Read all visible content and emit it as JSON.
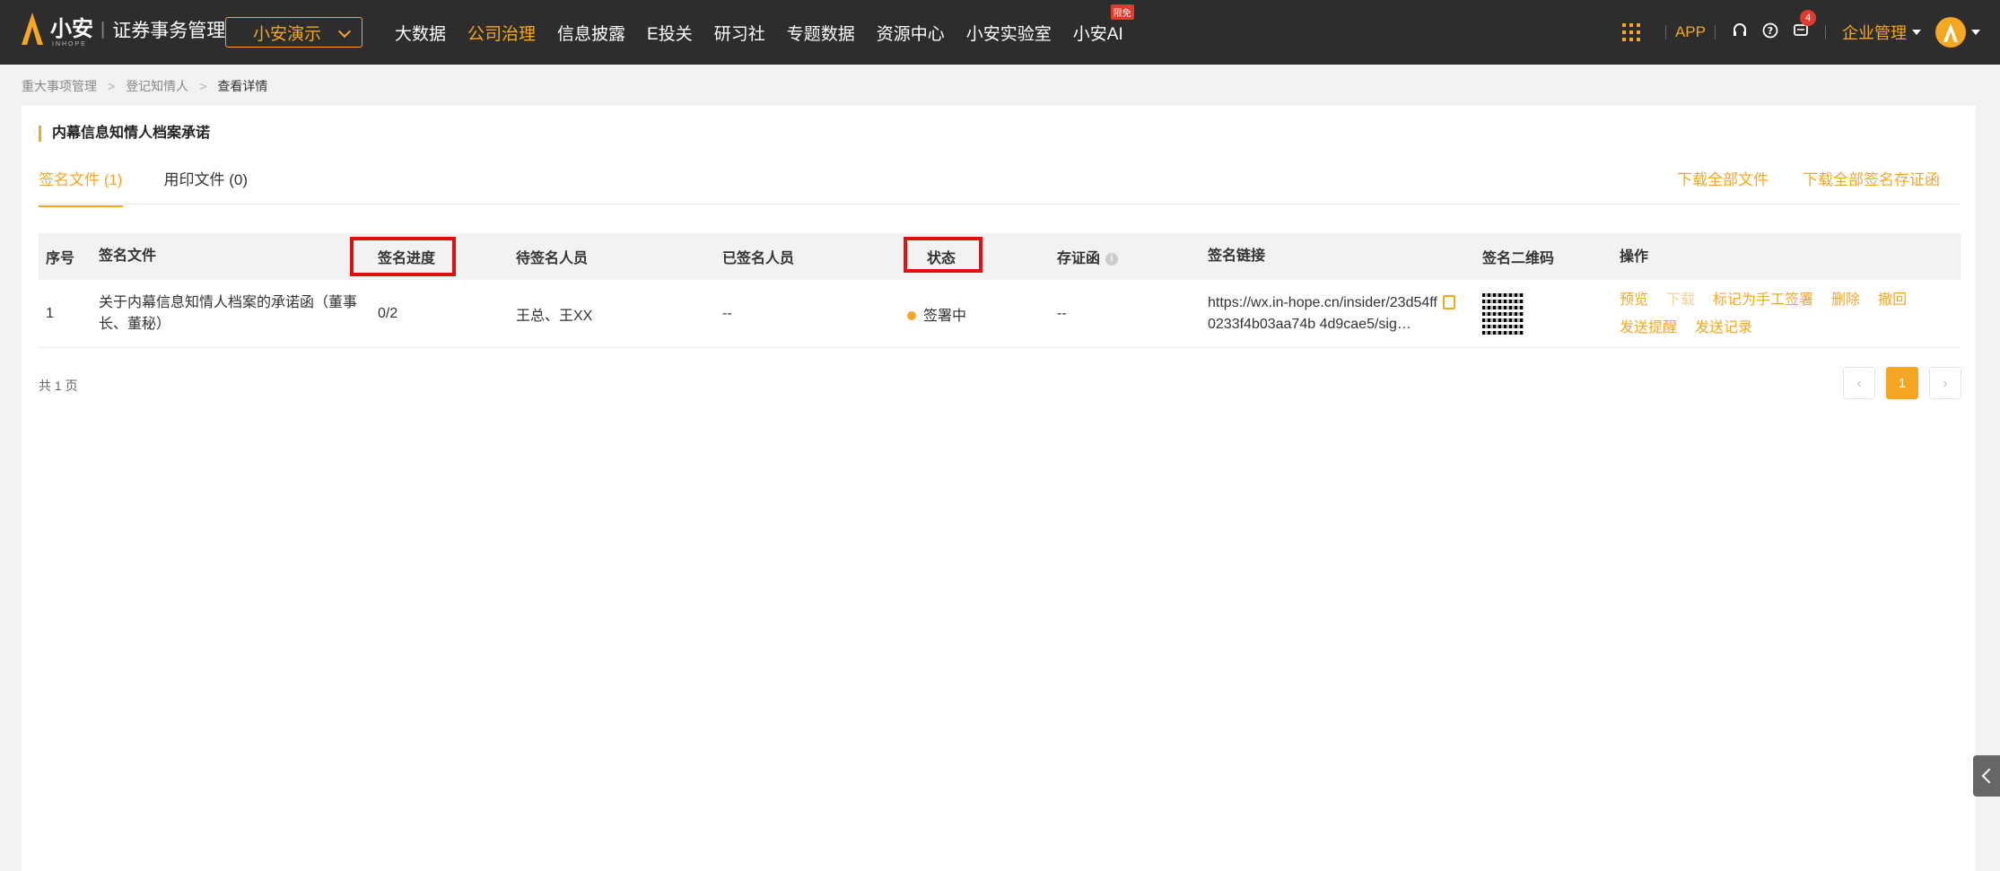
{
  "header": {
    "brand": "小安",
    "brand_sub": "INHOPE",
    "product": "证券事务管理",
    "company": "小安演示",
    "nav": [
      {
        "label": "大数据",
        "active": false
      },
      {
        "label": "公司治理",
        "active": true
      },
      {
        "label": "信息披露",
        "active": false
      },
      {
        "label": "E投关",
        "active": false
      },
      {
        "label": "研习社",
        "active": false
      },
      {
        "label": "专题数据",
        "active": false
      },
      {
        "label": "资源中心",
        "active": false
      },
      {
        "label": "小安实验室",
        "active": false
      },
      {
        "label": "小安AI",
        "active": false,
        "badge": "限免"
      }
    ],
    "app_label": "APP",
    "message_count": "4",
    "enterprise_label": "企业管理"
  },
  "breadcrumb": [
    "重大事项管理",
    "登记知情人",
    "查看详情"
  ],
  "section_title": "内幕信息知情人档案承诺",
  "tabs": [
    {
      "label": "签名文件 (1)",
      "active": true
    },
    {
      "label": "用印文件 (0)",
      "active": false
    }
  ],
  "top_links": [
    "下载全部文件",
    "下载全部签名存证函"
  ],
  "table": {
    "headers": [
      "序号",
      "签名文件",
      "签名进度",
      "待签名人员",
      "已签名人员",
      "状态",
      "存证函",
      "签名链接",
      "签名二维码",
      "操作"
    ],
    "rows": [
      {
        "seq": "1",
        "file": "关于内幕信息知情人档案的承诺函（董事长、董秘）",
        "progress": "0/2",
        "pending": "王总、王XX",
        "signed": "--",
        "status": "签署中",
        "cert": "--",
        "link_line1": "https://wx.in-hope.cn/insider/23d54ff",
        "link_line2": "0233f4b03aa74b      4d9cae5/sig…",
        "ops": [
          "预览",
          "下载",
          "标记为手工签署",
          "删除",
          "撤回",
          "发送提醒",
          "发送记录"
        ]
      }
    ]
  },
  "pagination": {
    "summary": "共 1 页",
    "current": "1"
  },
  "colors": {
    "accent": "#f5a623",
    "topbar": "#2d2d2d",
    "highlight": "#e01010"
  }
}
